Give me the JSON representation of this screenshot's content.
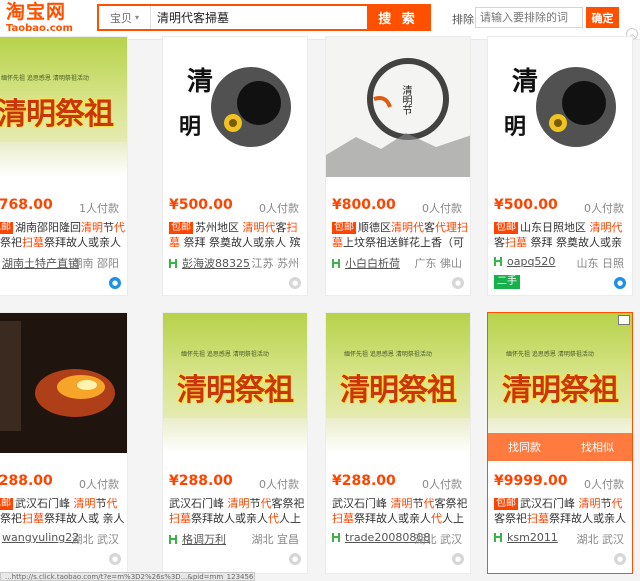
{
  "header": {
    "logo_cn": "淘宝网",
    "logo_en": "Taobao.com",
    "category": "宝贝",
    "search_value": "清明代客掃墓",
    "search_button": "搜 索",
    "sort_label": "排除",
    "sort_placeholder": "请输入要排除的词",
    "sort_button": "确定"
  },
  "art": {
    "banner_text": "清明祭祖",
    "qing": "清",
    "ming": "明",
    "qingmingjie": "清明节",
    "subtitle": "缅怀先祖 追思感恩 清明祭祖活动"
  },
  "colors": {
    "brand": "#ff5000",
    "price": "#ff4400",
    "highlight": "#ff4400",
    "secondhand": "#16b14b"
  },
  "items": [
    {
      "price": "¥768.00",
      "paid": "1人付款",
      "tag": "包邮",
      "title_parts": [
        "湖南邵阳隆回",
        "清明",
        "节",
        "代",
        "客",
        "祭祀",
        "扫墓",
        "祭拜故人或亲人",
        "代"
      ],
      "shop": "湖南土特产直销",
      "location": "湖南 邵阳",
      "badge": "blue"
    },
    {
      "price": "¥500.00",
      "paid": "0人付款",
      "tag": "包邮",
      "title_parts": [
        "苏州地区 ",
        "清明",
        "",
        "代",
        "客",
        "扫",
        "墓",
        " 祭拜 祭奠故人或亲人 殡葬"
      ],
      "shop": "彭海波88325",
      "location": "江苏 苏州",
      "badge": "gray"
    },
    {
      "price": "¥800.00",
      "paid": "0人付款",
      "tag": "包邮",
      "title_parts": [
        "顺德区",
        "清明",
        "",
        "代",
        "客",
        "代理扫",
        "墓",
        "上坟祭祖送鲜花上香（可拍"
      ],
      "shop": "小白白析荷",
      "location": "广东 佛山",
      "badge": "gray"
    },
    {
      "price": "¥500.00",
      "paid": "0人付款",
      "tag": "包邮",
      "title_parts": [
        "山东日照地区 ",
        "清明",
        "",
        "代",
        "客",
        "扫",
        "墓",
        " 祭拜 祭奠故人或亲人"
      ],
      "shop": "oapq520",
      "location": "山东 日照",
      "badge": "blue",
      "secondhand": "二手"
    },
    {
      "price": "¥288.00",
      "paid": "0人付款",
      "tag": "包邮",
      "title_parts": [
        "武汉石门峰 ",
        "清明",
        "节",
        "代",
        "客",
        "祭祀",
        "扫墓",
        "祭拜故人或 亲人",
        "代"
      ],
      "shop": "wangyuling22",
      "location": "湖北 武汉",
      "badge": "gray"
    },
    {
      "price": "¥288.00",
      "paid": "0人付款",
      "tag": "",
      "title_parts": [
        "武汉石门峰  ",
        "清明",
        "节",
        "代",
        "客",
        "祭祀",
        "扫墓",
        "祭拜故人或亲人",
        "代",
        "人上坟"
      ],
      "shop": "格调万利",
      "location": "湖北 宜昌",
      "badge": "gray"
    },
    {
      "price": "¥288.00",
      "paid": "0人付款",
      "tag": "",
      "title_parts": [
        "武汉石门峰  ",
        "清明",
        "节",
        "代",
        "客",
        "祭祀",
        "扫墓",
        "祭拜故人或亲人",
        "代",
        "人上坟"
      ],
      "shop": "trade20080808",
      "location": "湖北 武汉",
      "badge": "gray"
    },
    {
      "price": "¥9999.00",
      "paid": "0人付款",
      "tag": "包邮",
      "title_parts": [
        "武汉石门峰 ",
        "清明",
        "节",
        "代",
        "客",
        "祭祀",
        "扫墓",
        "祭拜故人或亲人",
        "代"
      ],
      "shop": "ksm2011",
      "location": "湖北 武汉",
      "badge": "gray",
      "hover_left": "找同款",
      "hover_right": "找相似"
    }
  ],
  "status_text": "...http://s.click.taobao.com/t?e=m%3D2%26s%3D...&pid=mm_12345678_0_0&unid=0"
}
